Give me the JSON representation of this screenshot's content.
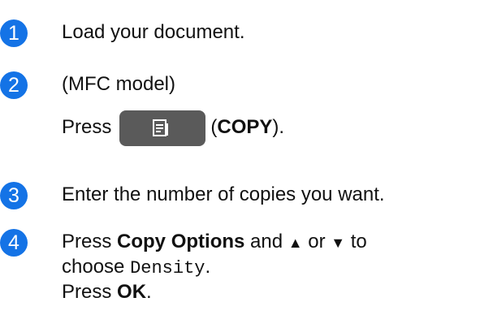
{
  "steps": [
    {
      "number": "1",
      "text": "Load your document."
    },
    {
      "number": "2",
      "line1": "(MFC model)",
      "press": "Press",
      "paren_open": "(",
      "button_name": "COPY",
      "paren_close": ")."
    },
    {
      "number": "3",
      "text": "Enter the number of copies you want."
    },
    {
      "number": "4",
      "press": "Press",
      "copy_options": "Copy Options",
      "and": "and",
      "up_arrow": "▲",
      "or": "or",
      "down_arrow": "▼",
      "to": "to",
      "choose": "choose",
      "density": "Density",
      "period": ".",
      "press2": "Press",
      "ok": "OK",
      "period2": "."
    }
  ],
  "colors": {
    "badge": "#1473e6",
    "copy_button": "#5a5a5a"
  },
  "icons": {
    "copy_button_icon": "copy-document-icon"
  }
}
